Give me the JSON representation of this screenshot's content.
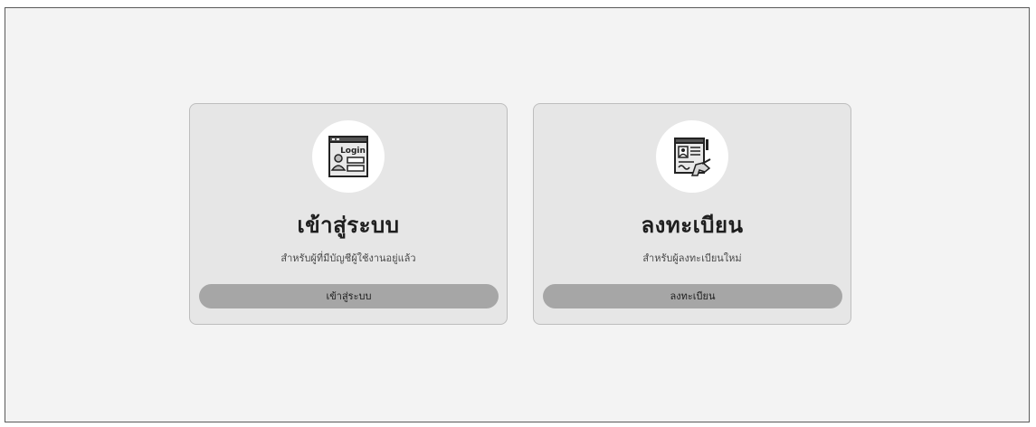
{
  "cards": [
    {
      "id": "login",
      "icon": "login-window-icon",
      "icon_text": "Login",
      "title": "เข้าสู่ระบบ",
      "subtitle": "สำหรับผู้ที่มีบัญชีผู้ใช้งานอยู่แล้ว",
      "button_label": "เข้าสู่ระบบ"
    },
    {
      "id": "register",
      "icon": "register-form-icon",
      "title": "ลงทะเบียน",
      "subtitle": "สำหรับผู้ลงทะเบียนใหม่",
      "button_label": "ลงทะเบียน"
    }
  ],
  "colors": {
    "page_background": "#f3f3f3",
    "card_background": "#e6e6e6",
    "button_background": "#a6a6a6",
    "text": "#1e1e1e"
  }
}
